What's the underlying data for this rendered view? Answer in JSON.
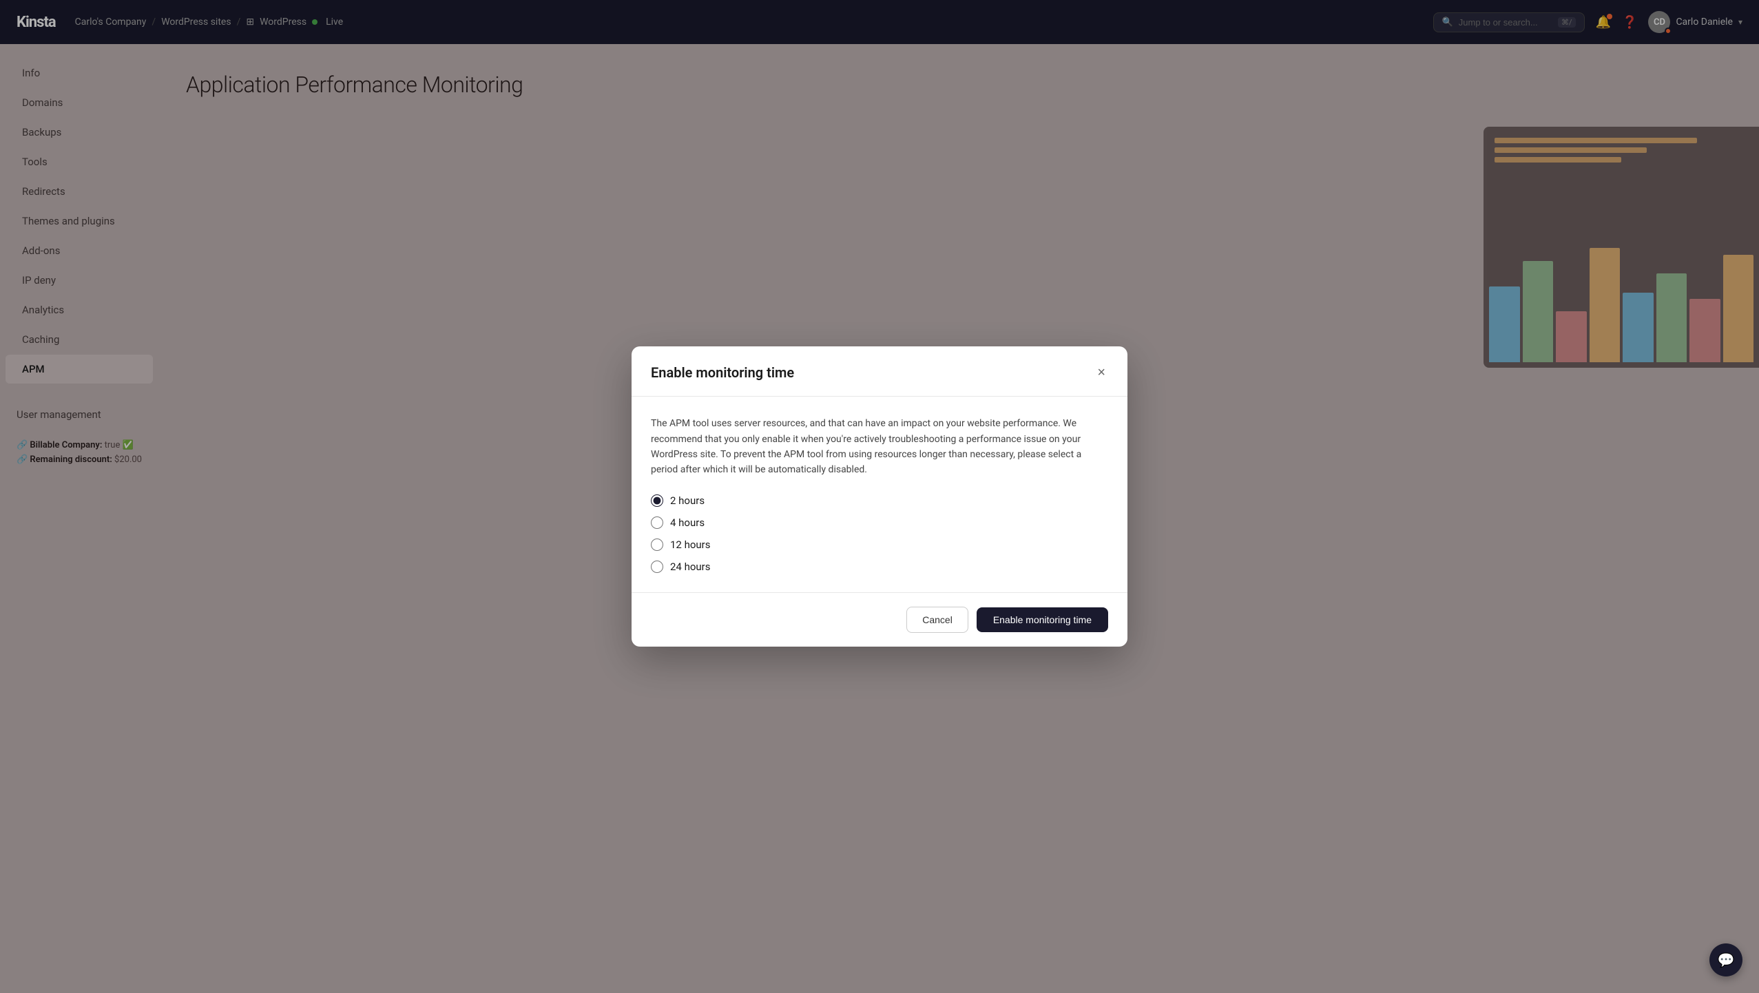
{
  "topnav": {
    "logo": "Kinsta",
    "breadcrumb": {
      "company": "Carlo's Company",
      "sep1": "/",
      "section": "WordPress sites",
      "sep2": "/",
      "site": "WordPress",
      "status": "Live"
    },
    "search_placeholder": "Jump to or search...",
    "shortcut": "⌘/",
    "user_name": "Carlo Daniele",
    "user_initials": "CD"
  },
  "sidebar": {
    "items": [
      {
        "id": "info",
        "label": "Info"
      },
      {
        "id": "domains",
        "label": "Domains"
      },
      {
        "id": "backups",
        "label": "Backups"
      },
      {
        "id": "tools",
        "label": "Tools"
      },
      {
        "id": "redirects",
        "label": "Redirects"
      },
      {
        "id": "themes-plugins",
        "label": "Themes and plugins"
      },
      {
        "id": "add-ons",
        "label": "Add-ons"
      },
      {
        "id": "ip-deny",
        "label": "IP deny"
      },
      {
        "id": "analytics",
        "label": "Analytics"
      },
      {
        "id": "caching",
        "label": "Caching"
      },
      {
        "id": "apm",
        "label": "APM",
        "active": true
      }
    ],
    "user_management": "User management",
    "billable_label": "Billable Company:",
    "billable_value": "true",
    "discount_label": "Remaining discount:",
    "discount_value": "$20.00"
  },
  "main": {
    "page_title": "Application Performance Monitoring"
  },
  "modal": {
    "title": "Enable monitoring time",
    "close_label": "×",
    "description": "The APM tool uses server resources, and that can have an impact on your website performance. We recommend that you only enable it when you're actively troubleshooting a performance issue on your WordPress site. To prevent the APM tool from using resources longer than necessary, please select a period after which it will be automatically disabled.",
    "options": [
      {
        "id": "2h",
        "label": "2 hours",
        "value": "2",
        "checked": true
      },
      {
        "id": "4h",
        "label": "4 hours",
        "value": "4",
        "checked": false
      },
      {
        "id": "12h",
        "label": "12 hours",
        "value": "12",
        "checked": false
      },
      {
        "id": "24h",
        "label": "24 hours",
        "value": "24",
        "checked": false
      }
    ],
    "cancel_label": "Cancel",
    "enable_label": "Enable monitoring time"
  }
}
